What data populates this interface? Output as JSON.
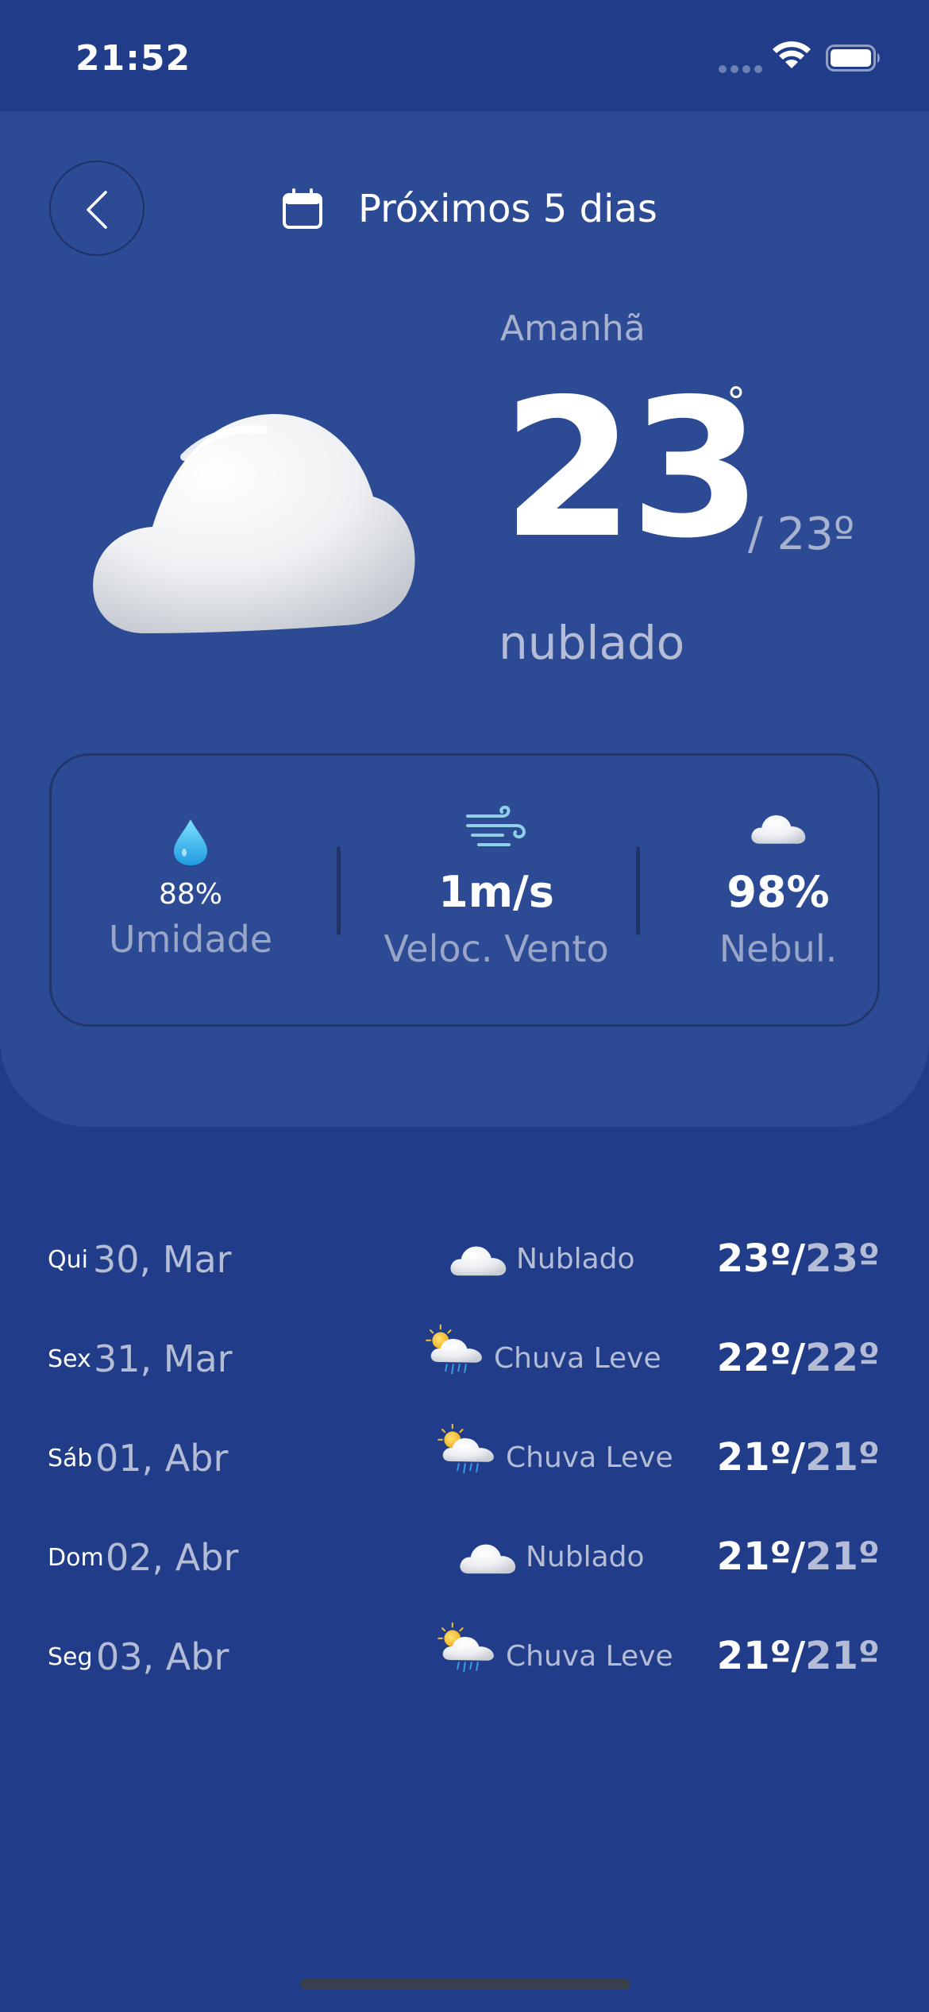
{
  "status_bar": {
    "time": "21:52"
  },
  "header": {
    "title": "Próximos 5 dias",
    "back_icon": "chevron-left-icon",
    "calendar_icon": "calendar-icon"
  },
  "current": {
    "day": "Amanhã",
    "temp": "23",
    "deg_symbol": "°",
    "min_temp": "/ 23º",
    "condition": "nublado",
    "icon": "cloud-icon"
  },
  "stats": [
    {
      "value": "88%",
      "label": "Umidade",
      "icon": "water-drop-icon"
    },
    {
      "value": "1m/s",
      "label": "Veloc. Vento",
      "icon": "wind-icon"
    },
    {
      "value": "98%",
      "label": "Nebul.",
      "icon": "cloud-icon"
    }
  ],
  "forecast": [
    {
      "weekday": "Qui",
      "date": "30, Mar",
      "condition": "Nublado",
      "icon": "cloud-icon",
      "max": "23º",
      "min": "23º"
    },
    {
      "weekday": "Sex",
      "date": "31, Mar",
      "condition": "Chuva Leve",
      "icon": "sun-rain-cloud-icon",
      "max": "22º",
      "min": "22º"
    },
    {
      "weekday": "Sáb",
      "date": "01, Abr",
      "condition": "Chuva Leve",
      "icon": "sun-rain-cloud-icon",
      "max": "21º",
      "min": "21º"
    },
    {
      "weekday": "Dom",
      "date": "02, Abr",
      "condition": "Nublado",
      "icon": "cloud-icon",
      "max": "21º",
      "min": "21º"
    },
    {
      "weekday": "Seg",
      "date": "03, Abr",
      "condition": "Chuva Leve",
      "icon": "sun-rain-cloud-icon",
      "max": "21º",
      "min": "21º"
    }
  ],
  "colors": {
    "background": "#213d8a",
    "card": "#2d4b94",
    "muted_text": "#b4bcd6"
  }
}
